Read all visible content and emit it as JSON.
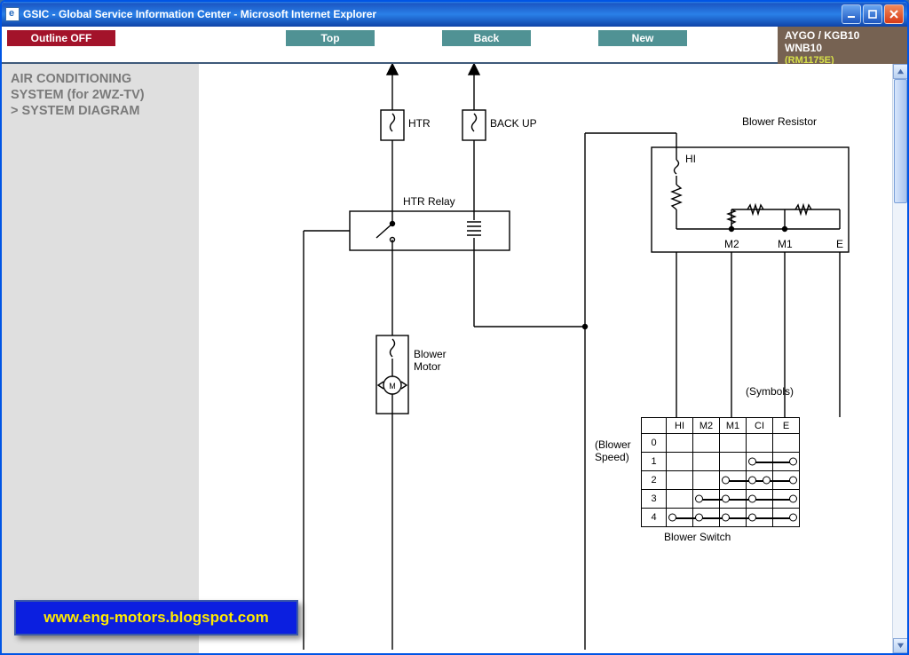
{
  "window": {
    "title": "GSIC - Global Service Information Center - Microsoft Internet Explorer",
    "buttons": {
      "minimize": "minimize",
      "maximize": "maximize",
      "close": "close"
    }
  },
  "toolbar": {
    "outline_label": "Outline OFF",
    "nav": {
      "top": "Top",
      "back": "Back",
      "new": "New"
    },
    "vehicle": {
      "line1": "AYGO / KGB10",
      "line2": "WNB10",
      "rm": "(RM1175E)"
    }
  },
  "left_heading": {
    "line1": "AIR CONDITIONING",
    "line2": "SYSTEM (for 2WZ-TV)",
    "line3": "> SYSTEM DIAGRAM"
  },
  "diagram": {
    "labels": {
      "htr": "HTR",
      "backup": "BACK UP",
      "htr_relay": "HTR Relay",
      "blower_motor": "Blower\nMotor",
      "blower_resistor": "Blower Resistor",
      "hi": "HI",
      "m2": "M2",
      "m1": "M1",
      "e": "E",
      "symbols": "(Symbols)",
      "blower_speed": "(Blower\nSpeed)",
      "blower_switch": "Blower Switch"
    },
    "switch_table": {
      "columns": [
        "HI",
        "M2",
        "M1",
        "CI",
        "E"
      ],
      "rows": [
        "0",
        "1",
        "2",
        "3",
        "4"
      ],
      "contacts": {
        "0": [],
        "1": [
          [
            "CI",
            "E"
          ]
        ],
        "2": [
          [
            "M1",
            "CI",
            "E"
          ]
        ],
        "3": [
          [
            "M2",
            "M1",
            "CI",
            "E"
          ]
        ],
        "4": [
          [
            "HI",
            "M2",
            "M1",
            "CI",
            "E"
          ]
        ]
      }
    }
  },
  "watermark": "www.eng-motors.blogspot.com"
}
